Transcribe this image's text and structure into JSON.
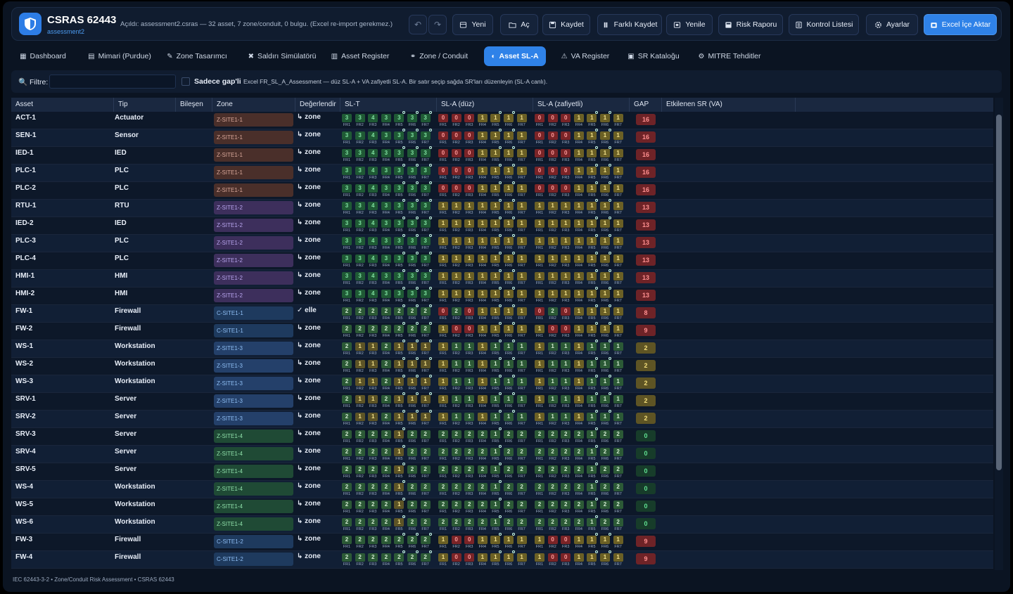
{
  "header": {
    "title": "CSRAS 62443",
    "subtitle": "assessment2",
    "status": "Açıldı: assessment2.csras — 32 asset, 7 zone/conduit, 0 bulgu. (Excel re-import gerekmez.)",
    "undo_label": "↶",
    "redo_label": "↷",
    "buttons": [
      {
        "label": "Yeni",
        "icon": "new-file-icon"
      },
      {
        "label": "Aç",
        "icon": "folder-open-icon"
      },
      {
        "label": "Kaydet",
        "icon": "save-icon"
      },
      {
        "label": "Farklı Kaydet",
        "icon": "save-as-icon"
      },
      {
        "label": "Yenile",
        "icon": "refresh-icon"
      },
      {
        "label": "Risk Raporu",
        "icon": "report-icon"
      },
      {
        "label": "Kontrol Listesi",
        "icon": "checklist-icon"
      },
      {
        "label": "Ayarlar",
        "icon": "gear-icon"
      },
      {
        "label": "Excel İçe Aktar",
        "icon": "import-icon"
      }
    ]
  },
  "tabs": [
    {
      "label": "Dashboard",
      "icon": "▦"
    },
    {
      "label": "Mimari (Purdue)",
      "icon": "▤"
    },
    {
      "label": "Zone Tasarımcı",
      "icon": "✎"
    },
    {
      "label": "Saldırı Simülatörü",
      "icon": "✖"
    },
    {
      "label": "Asset Register",
      "icon": "▥"
    },
    {
      "label": "Zone / Conduit",
      "icon": "⚭"
    },
    {
      "label": "Asset SL-A",
      "icon": "◐"
    },
    {
      "label": "VA Register",
      "icon": "⚠"
    },
    {
      "label": "SR Kataloğu",
      "icon": "▣"
    },
    {
      "label": "MITRE Tehditler",
      "icon": "⚙"
    }
  ],
  "filter": {
    "label": "Filtre:",
    "placeholder": "",
    "checkbox_label": "Sadece gap'li",
    "note": "Excel FR_SL_A_Assessment — düz SL-A + VA zafiyetli SL-A. Bir satır seçip sağda SR'ları düzenleyin (SL-A canlı)."
  },
  "columns": [
    "Asset",
    "Tip",
    "Bileşen",
    "Zone",
    "Değerlendir",
    "SL-T",
    "SL-A (düz)",
    "SL-A (zafiyetli)",
    "GAP",
    "Etkilenen SR (VA)"
  ],
  "fr_labels": [
    "FR1",
    "FR2",
    "FR3",
    "FR4",
    "FR5",
    "FR6",
    "FR7"
  ],
  "colors": {
    "zone_site1": "#4a2f2a",
    "zone_site2": "#3d2f5c",
    "zone_site3": "#24406a",
    "zone_site4": "#1f4a35",
    "conduit": "#1e3a5e",
    "cell_red": "#7a2427",
    "cell_yellow": "#6b6025",
    "cell_green": "#25603a",
    "cell_green_dark": "#1c4a2c"
  },
  "rows": [
    {
      "asset": "ACT-1",
      "tip": "Actuator",
      "bilesen": "",
      "zone": "Z-SITE1-1",
      "zc": "zone_site1",
      "eval": "↳ zone",
      "slt": [
        3,
        3,
        4,
        3,
        3,
        3,
        3
      ],
      "sla": [
        0,
        0,
        0,
        1,
        1,
        1,
        1
      ],
      "slv": [
        0,
        0,
        0,
        1,
        1,
        1,
        1
      ],
      "gap": 16
    },
    {
      "asset": "SEN-1",
      "tip": "Sensor",
      "bilesen": "",
      "zone": "Z-SITE1-1",
      "zc": "zone_site1",
      "eval": "↳ zone",
      "slt": [
        3,
        3,
        4,
        3,
        3,
        3,
        3
      ],
      "sla": [
        0,
        0,
        0,
        1,
        1,
        1,
        1
      ],
      "slv": [
        0,
        0,
        0,
        1,
        1,
        1,
        1
      ],
      "gap": 16
    },
    {
      "asset": "IED-1",
      "tip": "IED",
      "bilesen": "",
      "zone": "Z-SITE1-1",
      "zc": "zone_site1",
      "eval": "↳ zone",
      "slt": [
        3,
        3,
        4,
        3,
        3,
        3,
        3
      ],
      "sla": [
        0,
        0,
        0,
        1,
        1,
        1,
        1
      ],
      "slv": [
        0,
        0,
        0,
        1,
        1,
        1,
        1
      ],
      "gap": 16
    },
    {
      "asset": "PLC-1",
      "tip": "PLC",
      "bilesen": "",
      "zone": "Z-SITE1-1",
      "zc": "zone_site1",
      "eval": "↳ zone",
      "slt": [
        3,
        3,
        4,
        3,
        3,
        3,
        3
      ],
      "sla": [
        0,
        0,
        0,
        1,
        1,
        1,
        1
      ],
      "slv": [
        0,
        0,
        0,
        1,
        1,
        1,
        1
      ],
      "gap": 16
    },
    {
      "asset": "PLC-2",
      "tip": "PLC",
      "bilesen": "",
      "zone": "Z-SITE1-1",
      "zc": "zone_site1",
      "eval": "↳ zone",
      "slt": [
        3,
        3,
        4,
        3,
        3,
        3,
        3
      ],
      "sla": [
        0,
        0,
        0,
        1,
        1,
        1,
        1
      ],
      "slv": [
        0,
        0,
        0,
        1,
        1,
        1,
        1
      ],
      "gap": 16
    },
    {
      "asset": "RTU-1",
      "tip": "RTU",
      "bilesen": "",
      "zone": "Z-SITE1-2",
      "zc": "zone_site2",
      "eval": "↳ zone",
      "slt": [
        3,
        3,
        4,
        3,
        3,
        3,
        3
      ],
      "sla": [
        1,
        1,
        1,
        1,
        1,
        1,
        1
      ],
      "slv": [
        1,
        1,
        1,
        1,
        1,
        1,
        1
      ],
      "gap": 13
    },
    {
      "asset": "IED-2",
      "tip": "IED",
      "bilesen": "",
      "zone": "Z-SITE1-2",
      "zc": "zone_site2",
      "eval": "↳ zone",
      "slt": [
        3,
        3,
        4,
        3,
        3,
        3,
        3
      ],
      "sla": [
        1,
        1,
        1,
        1,
        1,
        1,
        1
      ],
      "slv": [
        1,
        1,
        1,
        1,
        1,
        1,
        1
      ],
      "gap": 13
    },
    {
      "asset": "PLC-3",
      "tip": "PLC",
      "bilesen": "",
      "zone": "Z-SITE1-2",
      "zc": "zone_site2",
      "eval": "↳ zone",
      "slt": [
        3,
        3,
        4,
        3,
        3,
        3,
        3
      ],
      "sla": [
        1,
        1,
        1,
        1,
        1,
        1,
        1
      ],
      "slv": [
        1,
        1,
        1,
        1,
        1,
        1,
        1
      ],
      "gap": 13
    },
    {
      "asset": "PLC-4",
      "tip": "PLC",
      "bilesen": "",
      "zone": "Z-SITE1-2",
      "zc": "zone_site2",
      "eval": "↳ zone",
      "slt": [
        3,
        3,
        4,
        3,
        3,
        3,
        3
      ],
      "sla": [
        1,
        1,
        1,
        1,
        1,
        1,
        1
      ],
      "slv": [
        1,
        1,
        1,
        1,
        1,
        1,
        1
      ],
      "gap": 13
    },
    {
      "asset": "HMI-1",
      "tip": "HMI",
      "bilesen": "",
      "zone": "Z-SITE1-2",
      "zc": "zone_site2",
      "eval": "↳ zone",
      "slt": [
        3,
        3,
        4,
        3,
        3,
        3,
        3
      ],
      "sla": [
        1,
        1,
        1,
        1,
        1,
        1,
        1
      ],
      "slv": [
        1,
        1,
        1,
        1,
        1,
        1,
        1
      ],
      "gap": 13
    },
    {
      "asset": "HMI-2",
      "tip": "HMI",
      "bilesen": "",
      "zone": "Z-SITE1-2",
      "zc": "zone_site2",
      "eval": "↳ zone",
      "slt": [
        3,
        3,
        4,
        3,
        3,
        3,
        3
      ],
      "sla": [
        1,
        1,
        1,
        1,
        1,
        1,
        1
      ],
      "slv": [
        1,
        1,
        1,
        1,
        1,
        1,
        1
      ],
      "gap": 13
    },
    {
      "asset": "FW-1",
      "tip": "Firewall",
      "bilesen": "",
      "zone": "C-SITE1-1",
      "zc": "conduit",
      "eval": "✓ elle",
      "slt": [
        2,
        2,
        2,
        2,
        2,
        2,
        2
      ],
      "sla": [
        0,
        2,
        0,
        1,
        1,
        1,
        1
      ],
      "slv": [
        0,
        2,
        0,
        1,
        1,
        1,
        1
      ],
      "gap": 8
    },
    {
      "asset": "FW-2",
      "tip": "Firewall",
      "bilesen": "",
      "zone": "C-SITE1-1",
      "zc": "conduit",
      "eval": "↳ zone",
      "slt": [
        2,
        2,
        2,
        2,
        2,
        2,
        2
      ],
      "sla": [
        1,
        0,
        0,
        1,
        1,
        1,
        1
      ],
      "slv": [
        1,
        0,
        0,
        1,
        1,
        1,
        1
      ],
      "gap": 9
    },
    {
      "asset": "WS-1",
      "tip": "Workstation",
      "bilesen": "",
      "zone": "Z-SITE1-3",
      "zc": "zone_site3",
      "eval": "↳ zone",
      "slt": [
        2,
        1,
        1,
        2,
        1,
        1,
        1
      ],
      "sla": [
        1,
        1,
        1,
        1,
        1,
        1,
        1
      ],
      "slv": [
        1,
        1,
        1,
        1,
        1,
        1,
        1
      ],
      "gap": 2
    },
    {
      "asset": "WS-2",
      "tip": "Workstation",
      "bilesen": "",
      "zone": "Z-SITE1-3",
      "zc": "zone_site3",
      "eval": "↳ zone",
      "slt": [
        2,
        1,
        1,
        2,
        1,
        1,
        1
      ],
      "sla": [
        1,
        1,
        1,
        1,
        1,
        1,
        1
      ],
      "slv": [
        1,
        1,
        1,
        1,
        1,
        1,
        1
      ],
      "gap": 2
    },
    {
      "asset": "WS-3",
      "tip": "Workstation",
      "bilesen": "",
      "zone": "Z-SITE1-3",
      "zc": "zone_site3",
      "eval": "↳ zone",
      "slt": [
        2,
        1,
        1,
        2,
        1,
        1,
        1
      ],
      "sla": [
        1,
        1,
        1,
        1,
        1,
        1,
        1
      ],
      "slv": [
        1,
        1,
        1,
        1,
        1,
        1,
        1
      ],
      "gap": 2
    },
    {
      "asset": "SRV-1",
      "tip": "Server",
      "bilesen": "",
      "zone": "Z-SITE1-3",
      "zc": "zone_site3",
      "eval": "↳ zone",
      "slt": [
        2,
        1,
        1,
        2,
        1,
        1,
        1
      ],
      "sla": [
        1,
        1,
        1,
        1,
        1,
        1,
        1
      ],
      "slv": [
        1,
        1,
        1,
        1,
        1,
        1,
        1
      ],
      "gap": 2
    },
    {
      "asset": "SRV-2",
      "tip": "Server",
      "bilesen": "",
      "zone": "Z-SITE1-3",
      "zc": "zone_site3",
      "eval": "↳ zone",
      "slt": [
        2,
        1,
        1,
        2,
        1,
        1,
        1
      ],
      "sla": [
        1,
        1,
        1,
        1,
        1,
        1,
        1
      ],
      "slv": [
        1,
        1,
        1,
        1,
        1,
        1,
        1
      ],
      "gap": 2
    },
    {
      "asset": "SRV-3",
      "tip": "Server",
      "bilesen": "",
      "zone": "Z-SITE1-4",
      "zc": "zone_site4",
      "eval": "↳ zone",
      "slt": [
        2,
        2,
        2,
        2,
        1,
        2,
        2
      ],
      "sla": [
        2,
        2,
        2,
        2,
        1,
        2,
        2
      ],
      "slv": [
        2,
        2,
        2,
        2,
        1,
        2,
        2
      ],
      "gap": 0
    },
    {
      "asset": "SRV-4",
      "tip": "Server",
      "bilesen": "",
      "zone": "Z-SITE1-4",
      "zc": "zone_site4",
      "eval": "↳ zone",
      "slt": [
        2,
        2,
        2,
        2,
        1,
        2,
        2
      ],
      "sla": [
        2,
        2,
        2,
        2,
        1,
        2,
        2
      ],
      "slv": [
        2,
        2,
        2,
        2,
        1,
        2,
        2
      ],
      "gap": 0
    },
    {
      "asset": "SRV-5",
      "tip": "Server",
      "bilesen": "",
      "zone": "Z-SITE1-4",
      "zc": "zone_site4",
      "eval": "↳ zone",
      "slt": [
        2,
        2,
        2,
        2,
        1,
        2,
        2
      ],
      "sla": [
        2,
        2,
        2,
        2,
        1,
        2,
        2
      ],
      "slv": [
        2,
        2,
        2,
        2,
        1,
        2,
        2
      ],
      "gap": 0
    },
    {
      "asset": "WS-4",
      "tip": "Workstation",
      "bilesen": "",
      "zone": "Z-SITE1-4",
      "zc": "zone_site4",
      "eval": "↳ zone",
      "slt": [
        2,
        2,
        2,
        2,
        1,
        2,
        2
      ],
      "sla": [
        2,
        2,
        2,
        2,
        1,
        2,
        2
      ],
      "slv": [
        2,
        2,
        2,
        2,
        1,
        2,
        2
      ],
      "gap": 0
    },
    {
      "asset": "WS-5",
      "tip": "Workstation",
      "bilesen": "",
      "zone": "Z-SITE1-4",
      "zc": "zone_site4",
      "eval": "↳ zone",
      "slt": [
        2,
        2,
        2,
        2,
        1,
        2,
        2
      ],
      "sla": [
        2,
        2,
        2,
        2,
        1,
        2,
        2
      ],
      "slv": [
        2,
        2,
        2,
        2,
        1,
        2,
        2
      ],
      "gap": 0
    },
    {
      "asset": "WS-6",
      "tip": "Workstation",
      "bilesen": "",
      "zone": "Z-SITE1-4",
      "zc": "zone_site4",
      "eval": "↳ zone",
      "slt": [
        2,
        2,
        2,
        2,
        1,
        2,
        2
      ],
      "sla": [
        2,
        2,
        2,
        2,
        1,
        2,
        2
      ],
      "slv": [
        2,
        2,
        2,
        2,
        1,
        2,
        2
      ],
      "gap": 0
    },
    {
      "asset": "FW-3",
      "tip": "Firewall",
      "bilesen": "",
      "zone": "C-SITE1-2",
      "zc": "conduit",
      "eval": "↳ zone",
      "slt": [
        2,
        2,
        2,
        2,
        2,
        2,
        2
      ],
      "sla": [
        1,
        0,
        0,
        1,
        1,
        1,
        1
      ],
      "slv": [
        1,
        0,
        0,
        1,
        1,
        1,
        1
      ],
      "gap": 9
    },
    {
      "asset": "FW-4",
      "tip": "Firewall",
      "bilesen": "",
      "zone": "C-SITE1-2",
      "zc": "conduit",
      "eval": "↳ zone",
      "slt": [
        2,
        2,
        2,
        2,
        2,
        2,
        2
      ],
      "sla": [
        1,
        0,
        0,
        1,
        1,
        1,
        1
      ],
      "slv": [
        1,
        0,
        0,
        1,
        1,
        1,
        1
      ],
      "gap": 9
    }
  ],
  "footer": "IEC 62443-3-2 • Zone/Conduit Risk Assessment • CSRAS 62443"
}
